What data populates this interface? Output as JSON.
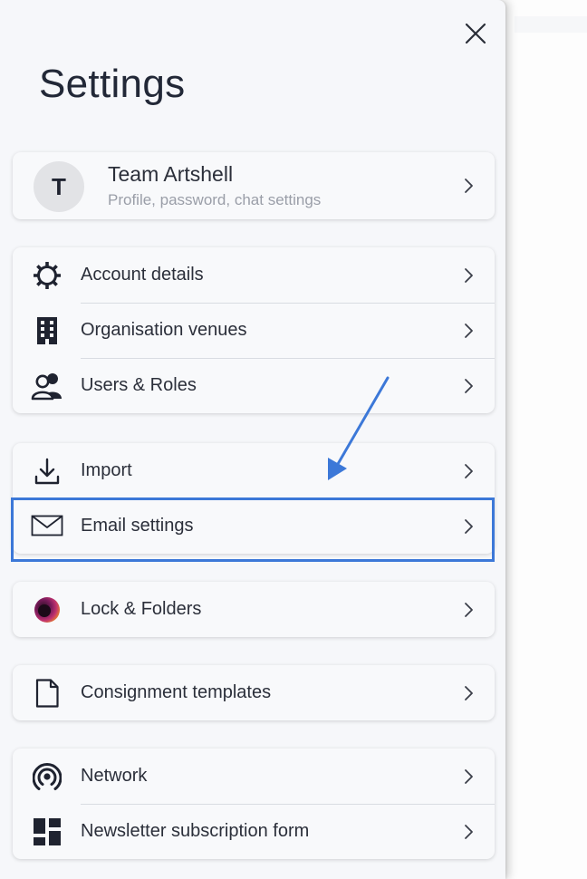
{
  "panel": {
    "title": "Settings",
    "close_icon": "close-icon"
  },
  "profile": {
    "initial": "T",
    "name": "Team Artshell",
    "subtitle": "Profile, password, chat settings"
  },
  "groups": [
    {
      "items": [
        {
          "label": "Account details",
          "icon": "gear-icon"
        },
        {
          "label": "Organisation venues",
          "icon": "building-icon"
        },
        {
          "label": "Users & Roles",
          "icon": "users-icon"
        }
      ]
    },
    {
      "items": [
        {
          "label": "Import",
          "icon": "download-icon"
        },
        {
          "label": "Email settings",
          "icon": "envelope-icon"
        }
      ]
    },
    {
      "items": [
        {
          "label": "Lock & Folders",
          "icon": "lock-folders-app-icon"
        }
      ]
    },
    {
      "items": [
        {
          "label": "Consignment templates",
          "icon": "document-icon"
        }
      ]
    },
    {
      "items": [
        {
          "label": "Network",
          "icon": "network-icon"
        },
        {
          "label": "Newsletter subscription form",
          "icon": "layout-icon"
        }
      ]
    }
  ],
  "annotation": {
    "highlight_color": "#3c78d8",
    "target": "Email settings"
  }
}
